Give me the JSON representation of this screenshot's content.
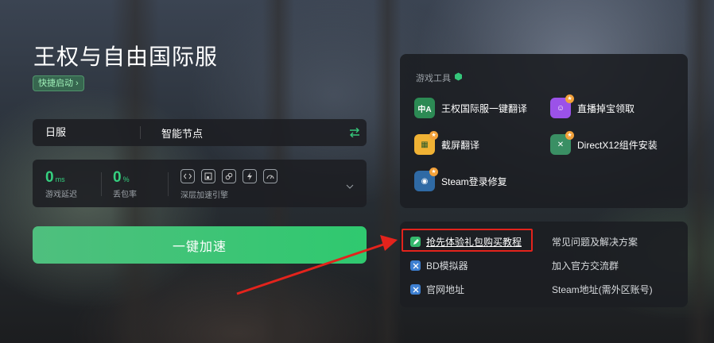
{
  "game_title": "王权与自由国际服",
  "quick_launch": "快捷启动",
  "node": {
    "region": "日服",
    "mode": "智能节点"
  },
  "stats": {
    "latency": {
      "value": "0",
      "unit": "ms",
      "label": "游戏延迟"
    },
    "loss": {
      "value": "0",
      "unit": "%",
      "label": "丢包率"
    },
    "deep_label": "深层加速引擎"
  },
  "accelerate_button": "一键加速",
  "tools": {
    "title": "游戏工具",
    "items": [
      {
        "label": "王权国际服一键翻译",
        "icon": "translate-icon"
      },
      {
        "label": "直播掉宝领取",
        "icon": "live-drop-icon"
      },
      {
        "label": "截屏翻译",
        "icon": "screenshot-translate-icon"
      },
      {
        "label": "DirectX12组件安装",
        "icon": "directx-icon"
      },
      {
        "label": "Steam登录修复",
        "icon": "steam-icon"
      }
    ]
  },
  "links": {
    "left": [
      "抢先体验礼包购买教程",
      "BD模拟器",
      "官网地址"
    ],
    "right": [
      "常见问题及解决方案",
      "加入官方交流群",
      "Steam地址(需外区账号)"
    ]
  },
  "colors": {
    "accent": "#35c67a",
    "highlight": "#e3231c",
    "panel": "#1c1e22"
  }
}
